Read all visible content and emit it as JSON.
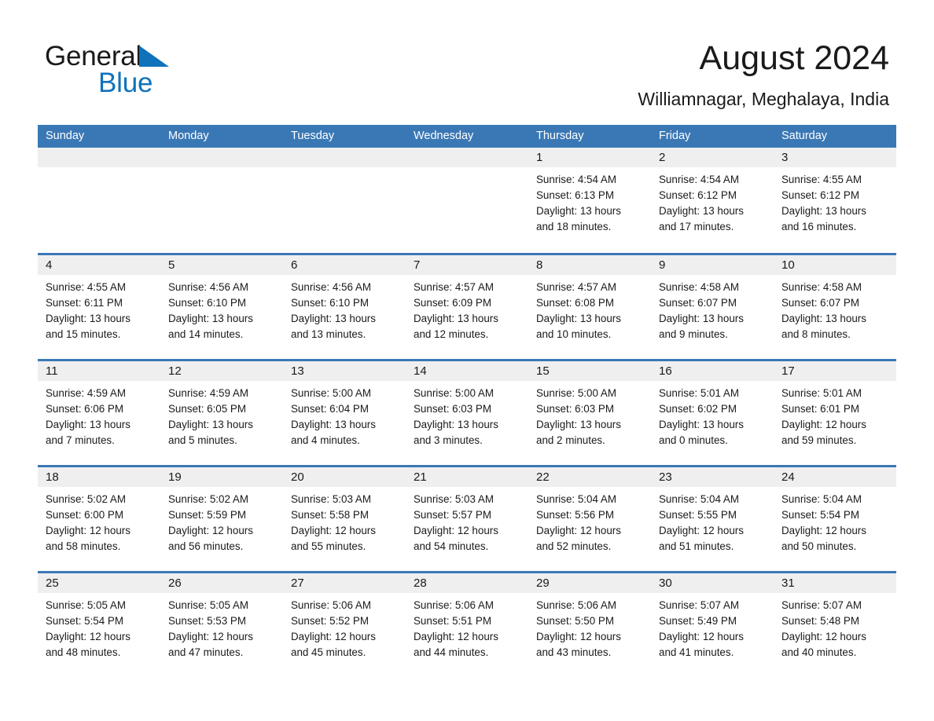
{
  "brand": {
    "name_part1": "General",
    "name_part2": "Blue",
    "triangle_color": "#1072bb",
    "text_color": "#1a1a1a"
  },
  "header": {
    "title": "August 2024",
    "subtitle": "Williamnagar, Meghalaya, India"
  },
  "calendar": {
    "header_bg": "#3a78b5",
    "day_strip_bg": "#efefef",
    "weekdays": [
      "Sunday",
      "Monday",
      "Tuesday",
      "Wednesday",
      "Thursday",
      "Friday",
      "Saturday"
    ],
    "weeks": [
      [
        {
          "day": "",
          "lines": []
        },
        {
          "day": "",
          "lines": []
        },
        {
          "day": "",
          "lines": []
        },
        {
          "day": "",
          "lines": []
        },
        {
          "day": "1",
          "lines": [
            "Sunrise: 4:54 AM",
            "Sunset: 6:13 PM",
            "Daylight: 13 hours",
            "and 18 minutes."
          ]
        },
        {
          "day": "2",
          "lines": [
            "Sunrise: 4:54 AM",
            "Sunset: 6:12 PM",
            "Daylight: 13 hours",
            "and 17 minutes."
          ]
        },
        {
          "day": "3",
          "lines": [
            "Sunrise: 4:55 AM",
            "Sunset: 6:12 PM",
            "Daylight: 13 hours",
            "and 16 minutes."
          ]
        }
      ],
      [
        {
          "day": "4",
          "lines": [
            "Sunrise: 4:55 AM",
            "Sunset: 6:11 PM",
            "Daylight: 13 hours",
            "and 15 minutes."
          ]
        },
        {
          "day": "5",
          "lines": [
            "Sunrise: 4:56 AM",
            "Sunset: 6:10 PM",
            "Daylight: 13 hours",
            "and 14 minutes."
          ]
        },
        {
          "day": "6",
          "lines": [
            "Sunrise: 4:56 AM",
            "Sunset: 6:10 PM",
            "Daylight: 13 hours",
            "and 13 minutes."
          ]
        },
        {
          "day": "7",
          "lines": [
            "Sunrise: 4:57 AM",
            "Sunset: 6:09 PM",
            "Daylight: 13 hours",
            "and 12 minutes."
          ]
        },
        {
          "day": "8",
          "lines": [
            "Sunrise: 4:57 AM",
            "Sunset: 6:08 PM",
            "Daylight: 13 hours",
            "and 10 minutes."
          ]
        },
        {
          "day": "9",
          "lines": [
            "Sunrise: 4:58 AM",
            "Sunset: 6:07 PM",
            "Daylight: 13 hours",
            "and 9 minutes."
          ]
        },
        {
          "day": "10",
          "lines": [
            "Sunrise: 4:58 AM",
            "Sunset: 6:07 PM",
            "Daylight: 13 hours",
            "and 8 minutes."
          ]
        }
      ],
      [
        {
          "day": "11",
          "lines": [
            "Sunrise: 4:59 AM",
            "Sunset: 6:06 PM",
            "Daylight: 13 hours",
            "and 7 minutes."
          ]
        },
        {
          "day": "12",
          "lines": [
            "Sunrise: 4:59 AM",
            "Sunset: 6:05 PM",
            "Daylight: 13 hours",
            "and 5 minutes."
          ]
        },
        {
          "day": "13",
          "lines": [
            "Sunrise: 5:00 AM",
            "Sunset: 6:04 PM",
            "Daylight: 13 hours",
            "and 4 minutes."
          ]
        },
        {
          "day": "14",
          "lines": [
            "Sunrise: 5:00 AM",
            "Sunset: 6:03 PM",
            "Daylight: 13 hours",
            "and 3 minutes."
          ]
        },
        {
          "day": "15",
          "lines": [
            "Sunrise: 5:00 AM",
            "Sunset: 6:03 PM",
            "Daylight: 13 hours",
            "and 2 minutes."
          ]
        },
        {
          "day": "16",
          "lines": [
            "Sunrise: 5:01 AM",
            "Sunset: 6:02 PM",
            "Daylight: 13 hours",
            "and 0 minutes."
          ]
        },
        {
          "day": "17",
          "lines": [
            "Sunrise: 5:01 AM",
            "Sunset: 6:01 PM",
            "Daylight: 12 hours",
            "and 59 minutes."
          ]
        }
      ],
      [
        {
          "day": "18",
          "lines": [
            "Sunrise: 5:02 AM",
            "Sunset: 6:00 PM",
            "Daylight: 12 hours",
            "and 58 minutes."
          ]
        },
        {
          "day": "19",
          "lines": [
            "Sunrise: 5:02 AM",
            "Sunset: 5:59 PM",
            "Daylight: 12 hours",
            "and 56 minutes."
          ]
        },
        {
          "day": "20",
          "lines": [
            "Sunrise: 5:03 AM",
            "Sunset: 5:58 PM",
            "Daylight: 12 hours",
            "and 55 minutes."
          ]
        },
        {
          "day": "21",
          "lines": [
            "Sunrise: 5:03 AM",
            "Sunset: 5:57 PM",
            "Daylight: 12 hours",
            "and 54 minutes."
          ]
        },
        {
          "day": "22",
          "lines": [
            "Sunrise: 5:04 AM",
            "Sunset: 5:56 PM",
            "Daylight: 12 hours",
            "and 52 minutes."
          ]
        },
        {
          "day": "23",
          "lines": [
            "Sunrise: 5:04 AM",
            "Sunset: 5:55 PM",
            "Daylight: 12 hours",
            "and 51 minutes."
          ]
        },
        {
          "day": "24",
          "lines": [
            "Sunrise: 5:04 AM",
            "Sunset: 5:54 PM",
            "Daylight: 12 hours",
            "and 50 minutes."
          ]
        }
      ],
      [
        {
          "day": "25",
          "lines": [
            "Sunrise: 5:05 AM",
            "Sunset: 5:54 PM",
            "Daylight: 12 hours",
            "and 48 minutes."
          ]
        },
        {
          "day": "26",
          "lines": [
            "Sunrise: 5:05 AM",
            "Sunset: 5:53 PM",
            "Daylight: 12 hours",
            "and 47 minutes."
          ]
        },
        {
          "day": "27",
          "lines": [
            "Sunrise: 5:06 AM",
            "Sunset: 5:52 PM",
            "Daylight: 12 hours",
            "and 45 minutes."
          ]
        },
        {
          "day": "28",
          "lines": [
            "Sunrise: 5:06 AM",
            "Sunset: 5:51 PM",
            "Daylight: 12 hours",
            "and 44 minutes."
          ]
        },
        {
          "day": "29",
          "lines": [
            "Sunrise: 5:06 AM",
            "Sunset: 5:50 PM",
            "Daylight: 12 hours",
            "and 43 minutes."
          ]
        },
        {
          "day": "30",
          "lines": [
            "Sunrise: 5:07 AM",
            "Sunset: 5:49 PM",
            "Daylight: 12 hours",
            "and 41 minutes."
          ]
        },
        {
          "day": "31",
          "lines": [
            "Sunrise: 5:07 AM",
            "Sunset: 5:48 PM",
            "Daylight: 12 hours",
            "and 40 minutes."
          ]
        }
      ]
    ]
  }
}
